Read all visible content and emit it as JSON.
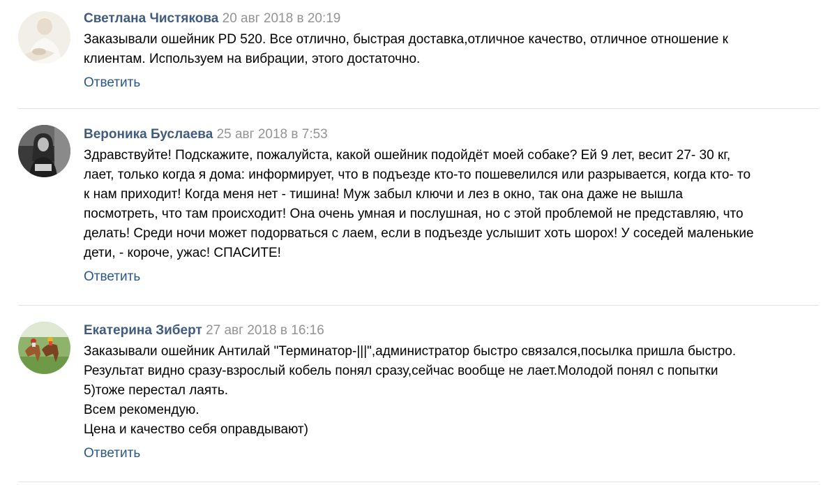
{
  "comments": [
    {
      "author": "Светлана Чистякова",
      "date": "20 авг 2018 в 20:19",
      "lines": [
        "Заказывали ошейник PD 520. Все отлично, быстрая доставка,отличное качество, отличное отношение к",
        "клиентам. Используем на вибрации, этого достаточно."
      ],
      "reply_label": "Ответить"
    },
    {
      "author": "Вероника Буслаева",
      "date": "25 авг 2018 в 7:53",
      "lines": [
        "Здравствуйте! Подскажите, пожалуйста, какой ошейник подойдёт моей собаке? Ей 9 лет, весит 27- 30 кг,",
        "лает, только когда я дома: информирует, что в подъезде кто-то пошевелился или разрывается, когда кто- то",
        "к нам приходит! Когда меня нет - тишина! Муж забыл ключи и лез в окно, так она даже не вышла",
        "посмотреть, что там происходит! Она очень умная и послушная, но с этой проблемой не представляю, что",
        "делать! Среди ночи может подорваться с лаем, если в подъезде услышит хоть шорох! У соседей маленькие",
        "дети, - короче, ужас! СПАСИТЕ!"
      ],
      "reply_label": "Ответить"
    },
    {
      "author": "Екатерина Зиберт",
      "date": "27 авг 2018 в 16:16",
      "lines": [
        "Заказывали ошейник Антилай \"Терминатор-|||\",администратор быстро связался,посылка пришла быстро.",
        "Результат видно сразу-взрослый кобель понял сразу,сейчас вообще не лает.Молодой понял с попытки",
        "5)тоже перестал лаять.",
        "Всем рекомендую.",
        "Цена и качество себя оправдывают)"
      ],
      "reply_label": "Ответить"
    }
  ],
  "colors": {
    "author": "#3f5c80",
    "date": "#939393",
    "reply": "#2a5885",
    "divider": "#dfe3e8"
  }
}
